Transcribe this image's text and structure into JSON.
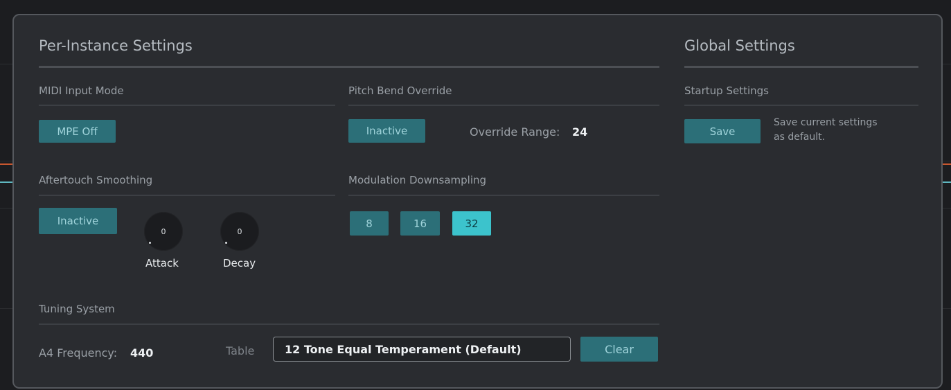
{
  "per_instance": {
    "title": "Per-Instance Settings",
    "midi_input_mode": {
      "label": "MIDI Input Mode",
      "button": "MPE Off"
    },
    "pitch_bend": {
      "label": "Pitch Bend Override",
      "button": "Inactive",
      "range_label": "Override Range:",
      "range_value": "24"
    },
    "aftertouch": {
      "label": "Aftertouch Smoothing",
      "button": "Inactive",
      "attack": {
        "value": "0",
        "label": "Attack"
      },
      "decay": {
        "value": "0",
        "label": "Decay"
      }
    },
    "modulation": {
      "label": "Modulation Downsampling",
      "options": [
        "8",
        "16",
        "32"
      ],
      "selected": "32"
    },
    "tuning": {
      "label": "Tuning System",
      "a4_label": "A4 Frequency:",
      "a4_value": "440",
      "table_label": "Table",
      "table_value": "12 Tone Equal Temperament (Default)",
      "clear_button": "Clear"
    }
  },
  "global": {
    "title": "Global Settings",
    "startup": {
      "label": "Startup Settings",
      "save_button": "Save",
      "description_line1": "Save current settings",
      "description_line2": "as default."
    }
  },
  "colors": {
    "panel_bg": "#2a2c30",
    "button_bg": "#2c6f78",
    "button_text": "#9fd3da",
    "active_button_bg": "#3cc3cc",
    "text_muted": "#9aa0a6"
  }
}
